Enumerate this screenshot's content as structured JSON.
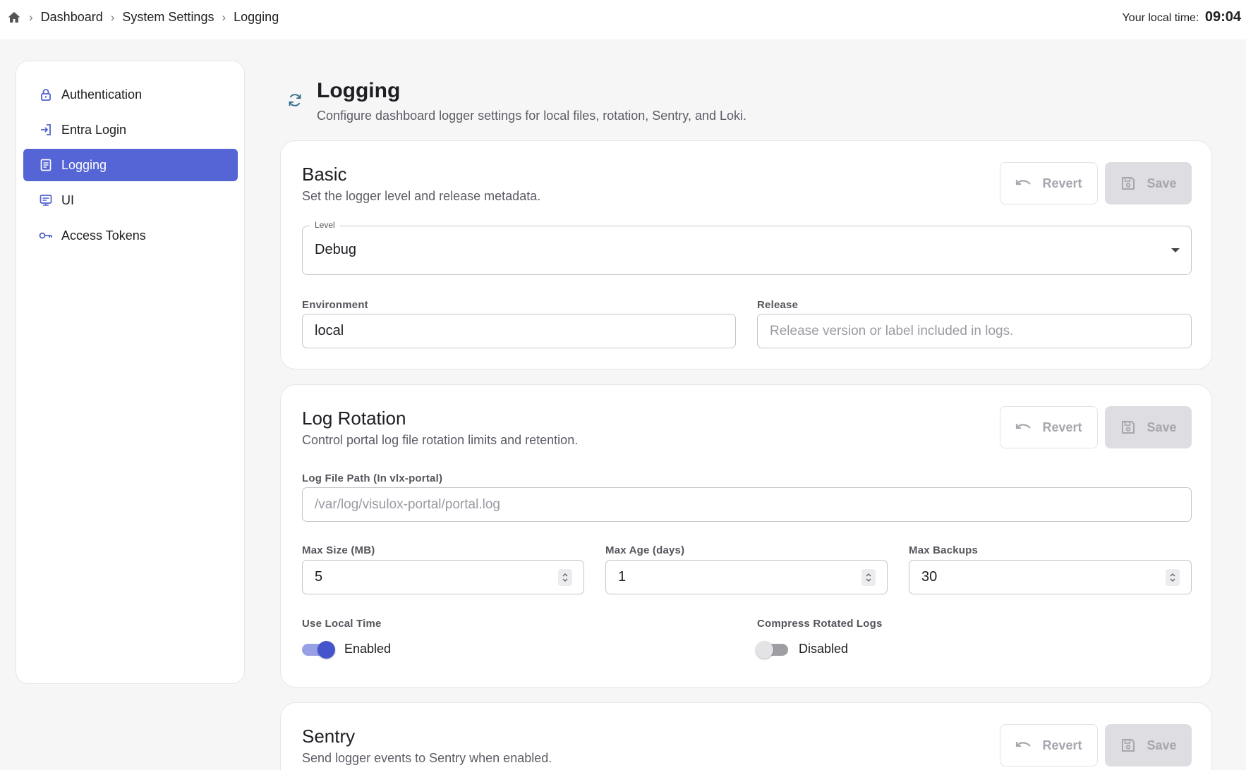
{
  "breadcrumb": [
    "Dashboard",
    "System Settings",
    "Logging"
  ],
  "local_time": {
    "label": "Your local time:",
    "value": "09:04"
  },
  "sidebar": {
    "items": [
      {
        "label": "Authentication",
        "icon": "lock-icon"
      },
      {
        "label": "Entra Login",
        "icon": "login-icon"
      },
      {
        "label": "Logging",
        "icon": "document-icon",
        "active": true
      },
      {
        "label": "UI",
        "icon": "monitor-icon"
      },
      {
        "label": "Access Tokens",
        "icon": "key-icon"
      }
    ]
  },
  "page": {
    "title": "Logging",
    "subtitle": "Configure dashboard logger settings for local files, rotation, Sentry, and Loki."
  },
  "buttons": {
    "revert": "Revert",
    "save": "Save"
  },
  "basic": {
    "title": "Basic",
    "subtitle": "Set the logger level and release metadata.",
    "level": {
      "label": "Level",
      "value": "Debug"
    },
    "environment": {
      "label": "Environment",
      "value": "local"
    },
    "release": {
      "label": "Release",
      "placeholder": "Release version or label included in logs."
    }
  },
  "rotation": {
    "title": "Log Rotation",
    "subtitle": "Control portal log file rotation limits and retention.",
    "path": {
      "label": "Log File Path (In vlx-portal)",
      "placeholder": "/var/log/visulox-portal/portal.log"
    },
    "max_size": {
      "label": "Max Size (MB)",
      "value": "5"
    },
    "max_age": {
      "label": "Max Age (days)",
      "value": "1"
    },
    "max_backups": {
      "label": "Max Backups",
      "value": "30"
    },
    "local_time": {
      "label": "Use Local Time",
      "state": "Enabled",
      "on": true
    },
    "compress": {
      "label": "Compress Rotated Logs",
      "state": "Disabled",
      "on": false
    }
  },
  "sentry": {
    "title": "Sentry",
    "subtitle": "Send logger events to Sentry when enabled."
  },
  "colors": {
    "accent": "#5565d6",
    "toggle_on": "#4455cc"
  }
}
